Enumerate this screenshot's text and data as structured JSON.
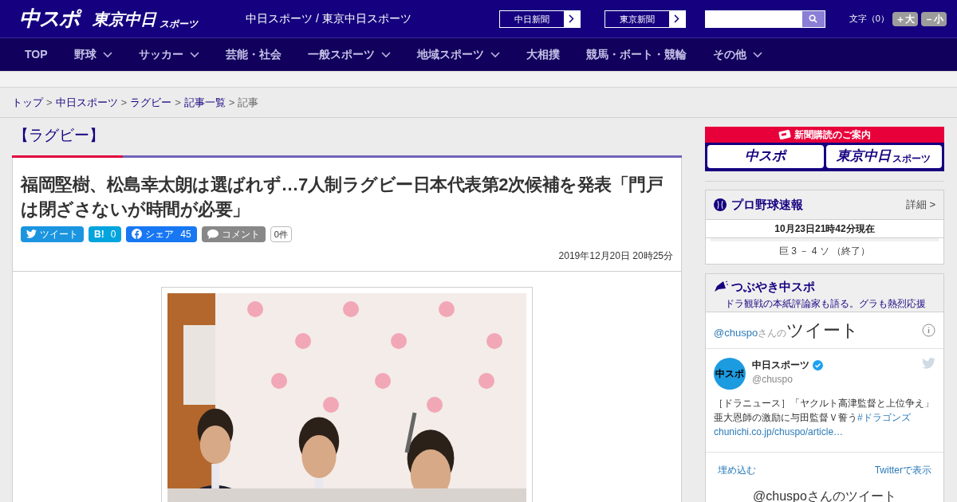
{
  "header": {
    "logo_main": "中スポ",
    "logo_tokyo": "東京中日",
    "logo_tokyo_sub": "スポーツ",
    "site_names": "中日スポーツ / 東京中日スポーツ",
    "paper_links": [
      {
        "label": "中日新聞"
      },
      {
        "label": "東京新聞"
      }
    ],
    "font_size": {
      "label": "文字（0）",
      "buttons": [
        "＋大",
        "－小"
      ]
    }
  },
  "nav": [
    {
      "label": "TOP",
      "has_menu": false
    },
    {
      "label": "野球",
      "has_menu": true
    },
    {
      "label": "サッカー",
      "has_menu": true
    },
    {
      "label": "芸能・社会",
      "has_menu": false
    },
    {
      "label": "一般スポーツ",
      "has_menu": true
    },
    {
      "label": "地域スポーツ",
      "has_menu": true
    },
    {
      "label": "大相撲",
      "has_menu": false
    },
    {
      "label": "競馬・ボート・競輪",
      "has_menu": false
    },
    {
      "label": "その他",
      "has_menu": true
    }
  ],
  "breadcrumb_separator": ">",
  "breadcrumb": [
    {
      "label": "トップ",
      "link": true
    },
    {
      "label": "中日スポーツ",
      "link": true
    },
    {
      "label": "ラグビー",
      "link": true
    },
    {
      "label": "記事一覧",
      "link": true
    },
    {
      "label": "記事",
      "link": false
    }
  ],
  "article": {
    "category": "【ラグビー】",
    "title": "福岡堅樹、松島幸太朗は選ばれず…7人制ラグビー日本代表第2次候補を発表「門戸は閉ざさないが時間が必要」",
    "share": [
      {
        "kind": "twitter",
        "label": "ツイート",
        "color": "#1b95e0"
      },
      {
        "kind": "hatena",
        "label": "B!",
        "count": "0",
        "color": "#00a4de"
      },
      {
        "kind": "facebook",
        "label": "シェア",
        "count": "45",
        "color": "#1877f2"
      },
      {
        "kind": "comment",
        "label": "コメント",
        "color": "#888888"
      }
    ],
    "comment_count": "0件",
    "date": "2019年12月20日 20時25分"
  },
  "sidebar": {
    "subscribe": {
      "title": "新聞購読のご案内",
      "logos": [
        "中スポ",
        "東京中日"
      ],
      "logo_sub": "スポーツ"
    },
    "baseball": {
      "title": "プロ野球速報",
      "detail": "詳細 >",
      "updated": "10月23日21時42分現在",
      "score": "巨 3 － 4 ソ （終了）"
    },
    "tweets": {
      "title": "つぶやき中スポ",
      "subtitle": "ドラ観戦の本紙評論家も語る。グラも熱烈応援",
      "handle": "@chuspo",
      "handle_suffix": "さんの",
      "heading": "ツイート",
      "author": "中日スポーツ",
      "author_handle": "@chuspo",
      "avatar": "中スポ",
      "text": "［ドラニュース］「ヤクルト高津監督と上位争え」亜大恩師の激励に与田監督Ｖ誓う",
      "hashtag": "#ドラゴンズ",
      "url": "chunichi.co.jp/chuspo/article…",
      "embed": "埋め込む",
      "view_on": "Twitterで表示",
      "footer": "@chuspoさんのツイート"
    }
  }
}
